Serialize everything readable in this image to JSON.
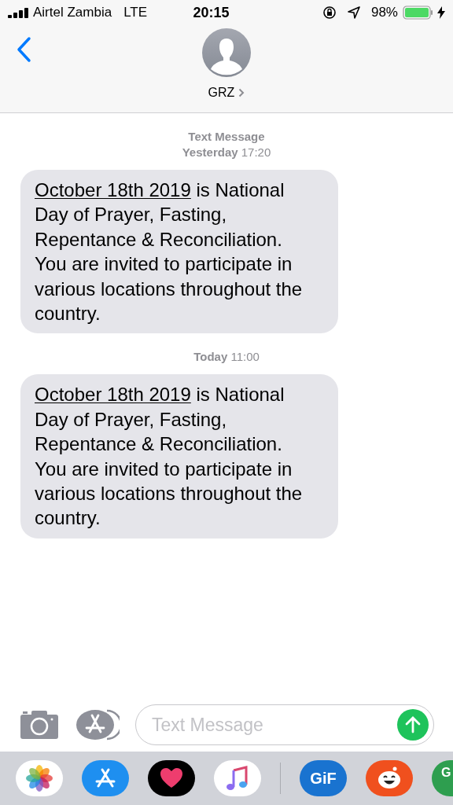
{
  "status_bar": {
    "carrier": "Airtel Zambia",
    "network": "LTE",
    "time": "20:15",
    "battery": "98%"
  },
  "header": {
    "contact": "GRZ"
  },
  "messages": [
    {
      "kind": "timestamp",
      "label": "Text Message",
      "time": "**Yesterday** 17:20"
    },
    {
      "kind": "bubble",
      "link": "October 18th 2019",
      "text": " is National Day of Prayer, Fasting, Repentance & Reconciliation. You are invited to participate in various locations throughout the country."
    },
    {
      "kind": "timestamp",
      "time": "**Today** 11:00"
    },
    {
      "kind": "bubble",
      "link": "October 18th 2019",
      "text": " is National Day of Prayer, Fasting, Repentance & Reconciliation. You are invited to participate in various locations throughout the country."
    }
  ],
  "composer": {
    "placeholder": "Text Message"
  },
  "app_drawer": [
    {
      "kind": "photos"
    },
    {
      "kind": "appstore"
    },
    {
      "kind": "heart"
    },
    {
      "kind": "music"
    },
    {
      "kind": "divider"
    },
    {
      "kind": "gif",
      "label": "GiF"
    },
    {
      "kind": "reddit"
    },
    {
      "kind": "maps",
      "label": "G"
    }
  ]
}
